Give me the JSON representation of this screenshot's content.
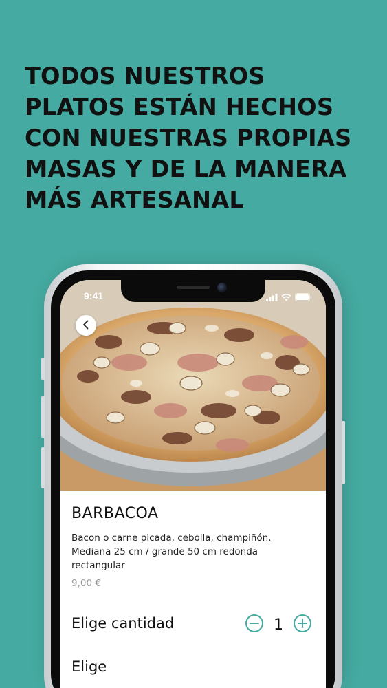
{
  "headline": {
    "lines": [
      "TODOS NUESTROS",
      "PLATOS ESTÁN HECHOS",
      "CON NUESTRAS PROPIAS",
      "MASAS Y DE LA MANERA",
      "MÁS ARTESANAL"
    ]
  },
  "status_bar": {
    "time": "9:41",
    "icons": [
      "signal-icon",
      "wifi-icon",
      "battery-icon"
    ]
  },
  "product": {
    "name": "BARBACOA",
    "description": "Bacon o carne picada, cebolla, champiñón. Mediana 25 cm / grande 50 cm redonda rectangular",
    "price": "9,00 €"
  },
  "quantity": {
    "label": "Elige cantidad",
    "value": "1"
  },
  "choose": {
    "label": "Elige"
  },
  "colors": {
    "background": "#45aaa1",
    "accent": "#45aaa1",
    "text": "#111111",
    "muted": "#9a9a9a"
  }
}
